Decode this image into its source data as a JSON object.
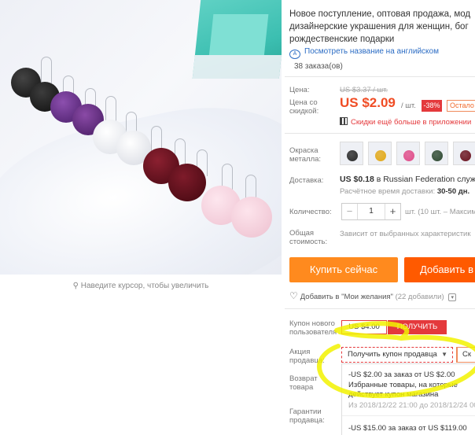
{
  "image": {
    "zoom_hint": "Наведите курсор, чтобы увеличить"
  },
  "product": {
    "title_lines": [
      "Новое поступление, оптовая продажа, мод",
      "дизайнерские украшения для женщин, бог",
      "рождественские подарки"
    ],
    "translate_link": "Посмотреть название на английском",
    "orders": "38 заказа(ов)"
  },
  "price": {
    "label": "Цена:",
    "old": "US $3.37 / шт.",
    "discount_label": "Цена со скидкой:",
    "new": "US $2.09",
    "unit": "/ шт.",
    "discount": "-38%",
    "remaining": "Остало",
    "app_promo": "Скидки ещё больше в приложении"
  },
  "color": {
    "label": "Окраска металла:",
    "swatches": [
      {
        "name": "black",
        "color": "#2a2a2a"
      },
      {
        "name": "yellow",
        "color": "#e2a919"
      },
      {
        "name": "pink",
        "color": "#e04d8a"
      },
      {
        "name": "green",
        "color": "#2f4a32"
      },
      {
        "name": "burgundy",
        "color": "#6b1420"
      }
    ]
  },
  "shipping": {
    "label": "Доставка:",
    "price": "US $0.18",
    "to": "в Russian Federation служб",
    "time_label": "Расчётное время доставки:",
    "time_value": "30-50 дн."
  },
  "quantity": {
    "label": "Количество:",
    "value": "1",
    "unit_note": "шт. (10 шт. – Максимум"
  },
  "total": {
    "label": "Общая стоимость:",
    "note": "Зависит от выбранных характеристик"
  },
  "actions": {
    "buy": "Купить сейчас",
    "cart": "Добавить в"
  },
  "wishlist": {
    "label": "Добавить в \"Мои желания\"",
    "count": "(22 добавили)"
  },
  "coupons": {
    "new_user_label": "Купон нового пользователя",
    "new_user_value": "US $4.00",
    "get": "ПОЛУЧИТЬ",
    "seller_label": "Акция продавца:",
    "seller_select": "Получить купон продавца",
    "seller_select2": "Ск",
    "return_label": "Возврат товара",
    "guarantee_label": "Гарантии продавца:",
    "offer1_line1": "-US $2.00 за заказ от US $2.00",
    "offer1_line2": "Избранные товары, на которые",
    "offer1_line3": "действует купон магазина",
    "offer1_date": "Из 2018/12/22 21:00 до 2018/12/24 00",
    "offer2_line1": "-US $15.00 за заказ от US $119.00"
  },
  "colors": {
    "accent": "#ff5a00",
    "price": "#f04c24",
    "red": "#e4393c",
    "link": "#2b6cc4",
    "highlight": "#f2f200"
  }
}
